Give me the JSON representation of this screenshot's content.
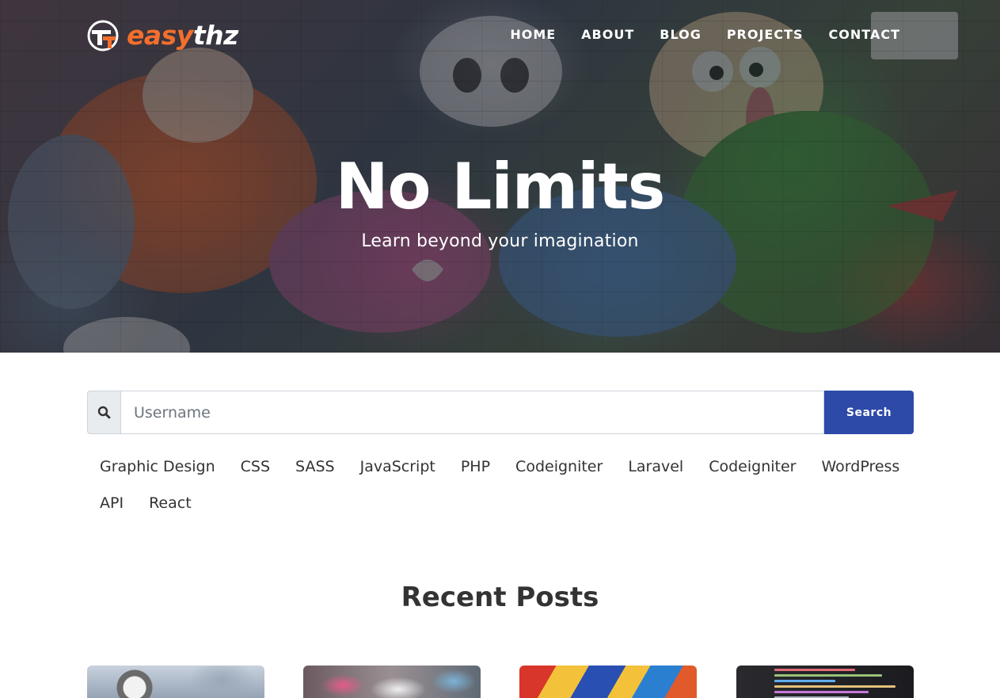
{
  "brand": {
    "part1": "easy",
    "part2": "thz",
    "accent_color": "#f36f2c"
  },
  "nav": {
    "items": [
      "HOME",
      "ABOUT",
      "BLOG",
      "PROJECTS",
      "CONTACT"
    ]
  },
  "hero": {
    "title": "No Limits",
    "subtitle": "Learn beyond your imagination"
  },
  "search": {
    "icon": "search-icon",
    "placeholder": "Username",
    "value": "",
    "button_label": "Search",
    "button_color": "#2d4aa8"
  },
  "tags": [
    "Graphic Design",
    "CSS",
    "SASS",
    "JavaScript",
    "PHP",
    "Codeigniter",
    "Laravel",
    "Codeigniter",
    "WordPress",
    "API",
    "React"
  ],
  "recent_posts": {
    "title": "Recent Posts",
    "cards": [
      {
        "image": "astronaut-photo"
      },
      {
        "image": "graffiti-wall-photo"
      },
      {
        "image": "colorful-graffiti-photo"
      },
      {
        "image": "code-screen-photo"
      }
    ]
  }
}
